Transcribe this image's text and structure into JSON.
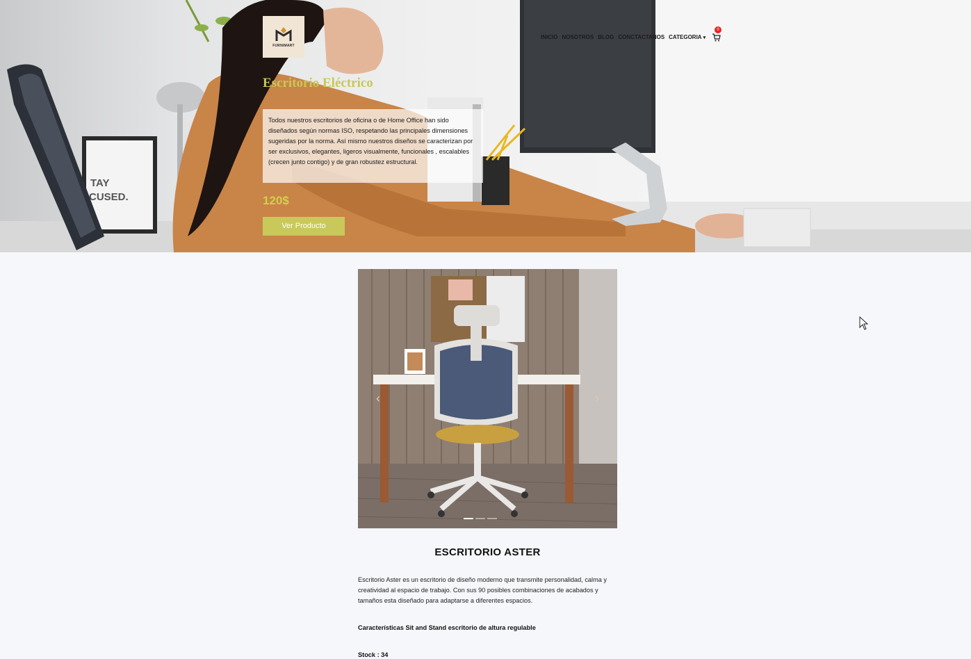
{
  "brand": {
    "logo_text": "FURNIMART"
  },
  "nav": {
    "items": [
      "INICIO",
      "NOSOTROS",
      "BLOG",
      "CONCTACTANOS"
    ],
    "dropdown_label": "CATEGORIA",
    "cart_count": "0"
  },
  "hero": {
    "title": "Escritorio Eléctrico",
    "description": "Todos nuestros escritorios de oficina o de Home Office han sido diseñados según normas ISO, respetando las principales dimensiones sugeridas por la norma. Así mismo nuestros diseños se caracterizan por ser exclusivos, elegantes, ligeros visualmente, funcionales , escalables (crecen junto contigo) y de gran robustez estructural.",
    "price": "120$",
    "button_label": "Ver Producto",
    "poster_text": [
      "TAY",
      "CUSED."
    ]
  },
  "product": {
    "title": "ESCRITORIO ASTER",
    "description": "Escritorio Aster es un escritorio de diseño moderno que transmite personalidad, calma y creatividad al espacio de trabajo. Con sus 90 posibles combinaciones de acabados y tamaños esta diseñado para adaptarse a diferentes espacios.",
    "features_label": "Características Sit and Stand escritorio de altura regulable",
    "stock_label": "Stock : 34",
    "carousel": {
      "prev_icon": "‹",
      "next_icon": "›",
      "slide_count": 3,
      "active_index": 0
    }
  },
  "colors": {
    "accent": "#c8c95a",
    "price": "#cfd14a",
    "badge": "#e82323",
    "background": "#f5f7fa"
  }
}
